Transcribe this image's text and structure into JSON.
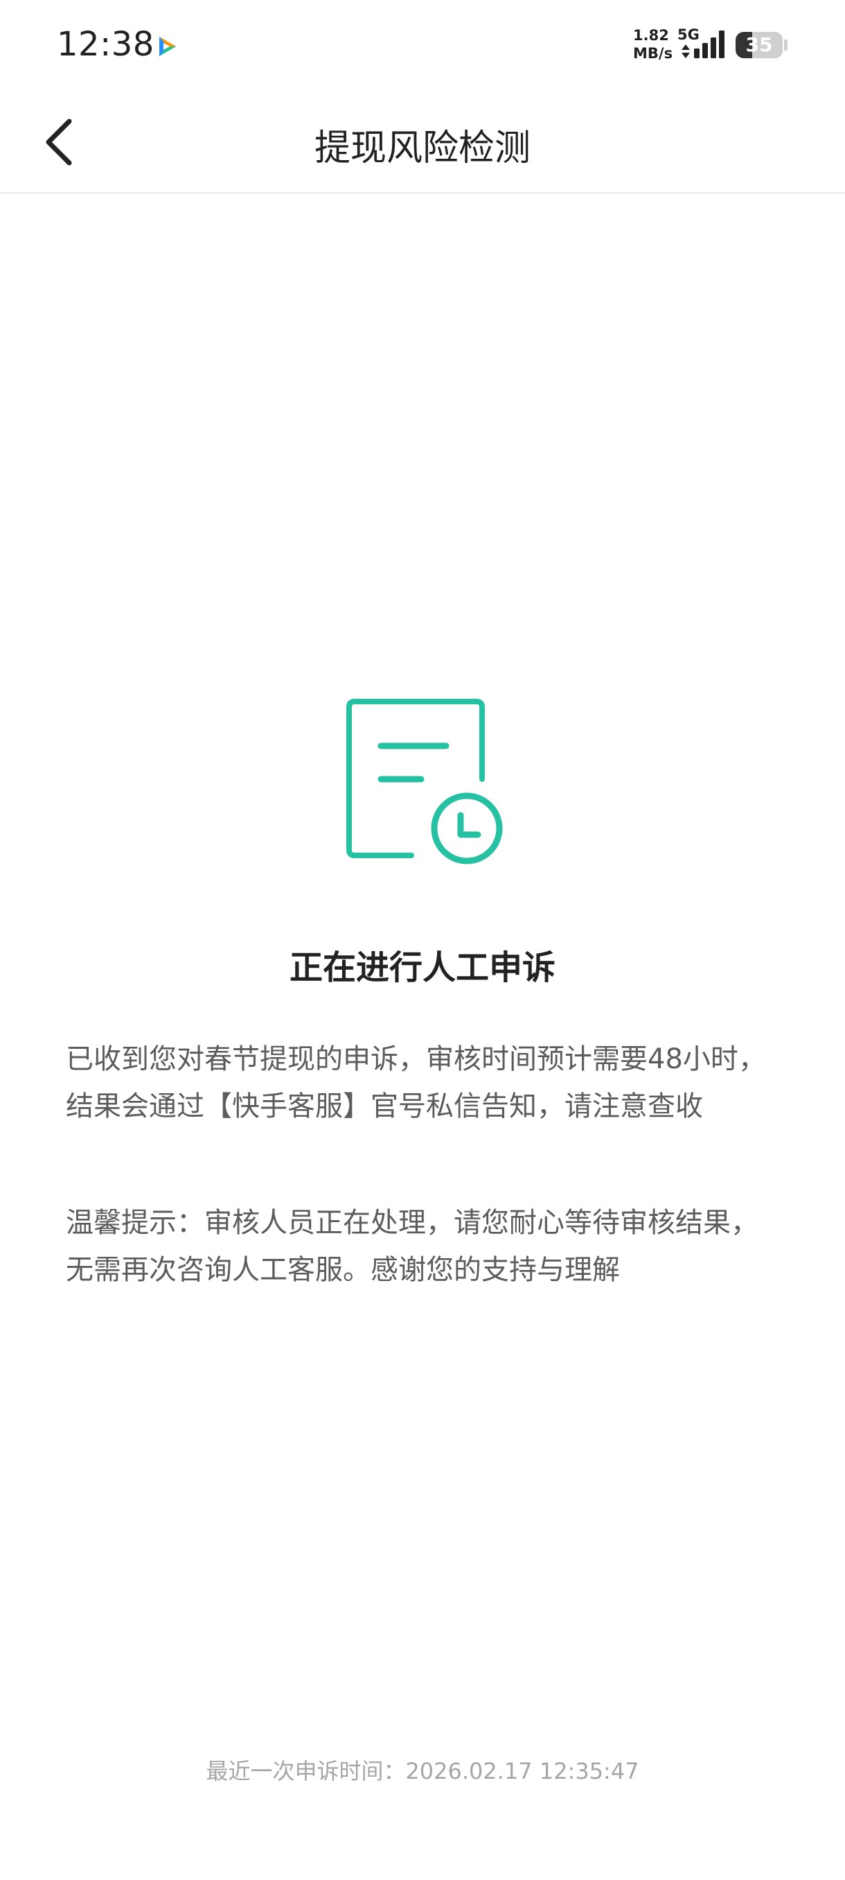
{
  "status_bar": {
    "time": "12:38",
    "net_speed_value": "1.82",
    "net_speed_unit": "MB/s",
    "network_type": "5G",
    "battery_level": "35",
    "battery_fraction": 0.35
  },
  "nav": {
    "back_icon": "chevron-left-icon",
    "title": "提现风险检测"
  },
  "main": {
    "illustration_icon": "document-clock-icon",
    "accent_color": "#25c1a2",
    "heading": "正在进行人工申诉",
    "message_1": "已收到您对春节提现的申诉，审核时间预计需要48小时，结果会通过【快手客服】官号私信告知，请注意查收",
    "message_2": "温馨提示：审核人员正在处理，请您耐心等待审核结果，无需再次咨询人工客服。感谢您的支持与理解"
  },
  "footer": {
    "last_appeal_time": "最近一次申诉时间：2026.02.17 12:35:47"
  }
}
